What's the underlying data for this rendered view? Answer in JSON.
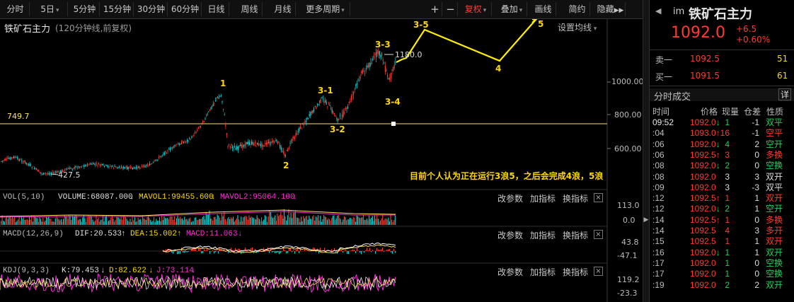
{
  "toolbar": {
    "period_tabs": [
      "分时",
      "5日",
      "5分钟",
      "15分钟",
      "30分钟",
      "60分钟",
      "日线",
      "周线",
      "月线",
      "更多周期"
    ],
    "zoom_in": "+",
    "zoom_out": "−",
    "fq": "复权",
    "overlay": "叠加",
    "draw": "画线",
    "simple": "简约",
    "hide": "隐藏"
  },
  "chart": {
    "title": "铁矿石主力",
    "subtitle": "(120分钟线,前复权)",
    "setting": "设置均线",
    "price_axis": [
      "1000.00",
      "800.00",
      "600.00"
    ],
    "hline_label": "749.7",
    "high_label": "1180.0",
    "low_label": "427.5",
    "wave_labels": [
      "1",
      "2",
      "3-1",
      "3-2",
      "3-3",
      "3-4",
      "3-5",
      "4",
      "5"
    ],
    "annotation": "目前个人认为正在运行3浪5，之后会完成4浪，5浪",
    "colors": {
      "up": "#ff3b30",
      "down": "#00d8d8",
      "wave": "#ffee00",
      "hline": "#ffe066"
    }
  },
  "vol": {
    "name": "VOL(5,10)",
    "volume": "VOLUME:68087.000",
    "mavol1": "MAVOL1:99455.600",
    "mavol2": "MAVOL2:95064.100",
    "axis": [
      "113.0",
      "0.0"
    ]
  },
  "macd": {
    "name": "MACD(12,26,9)",
    "dif": "DIF:20.533",
    "dea": "DEA:15.002",
    "macd": "MACD:11.063",
    "axis": [
      "43.8",
      "-47.1"
    ]
  },
  "kdj": {
    "name": "KDJ(9,3,3)",
    "k": "K:79.453",
    "d": "D:82.622",
    "j": "J:73.114",
    "axis": [
      "119.2",
      "-23.3"
    ]
  },
  "panel_actions": {
    "params": "改参数",
    "add": "加指标",
    "switch": "换指标",
    "close": "×"
  },
  "quote": {
    "code": "im",
    "name": "铁矿石主力",
    "price": "1092.0",
    "change": "+6.5",
    "change_pct": "+0.60%",
    "sell_label": "卖一",
    "sell_price": "1092.5",
    "sell_vol": "51",
    "buy_label": "买一",
    "buy_price": "1091.5",
    "buy_vol": "61",
    "ticks_title": "分时成交",
    "detail_btn": "详",
    "headers": [
      "时间",
      "价格",
      "现量",
      "仓差",
      "性质"
    ]
  },
  "trades": [
    {
      "time": "09:52",
      "price": "1092.0",
      "dir": "↓",
      "vol": "1",
      "oi": "-1",
      "type": "双平",
      "pc": "up",
      "tc": "dn"
    },
    {
      "time": ":04",
      "price": "1093.0",
      "dir": "↑",
      "vol": "16",
      "oi": "-1",
      "type": "空平",
      "pc": "up",
      "tc": "up"
    },
    {
      "time": ":06",
      "price": "1092.0",
      "dir": "↓",
      "vol": "4",
      "oi": "2",
      "type": "空开",
      "pc": "up",
      "tc": "dn"
    },
    {
      "time": ":06",
      "price": "1092.5",
      "dir": "↑",
      "vol": "3",
      "oi": "0",
      "type": "多换",
      "pc": "up",
      "tc": "up"
    },
    {
      "time": ":08",
      "price": "1092.0",
      "dir": "↓",
      "vol": "2",
      "oi": "0",
      "type": "空换",
      "pc": "up",
      "tc": "dn"
    },
    {
      "time": ":08",
      "price": "1092.0",
      "dir": "",
      "vol": "3",
      "oi": "3",
      "type": "双开",
      "pc": "up",
      "tc": "wh"
    },
    {
      "time": ":09",
      "price": "1092.0",
      "dir": "",
      "vol": "3",
      "oi": "-3",
      "type": "双平",
      "pc": "up",
      "tc": "wh"
    },
    {
      "time": ":12",
      "price": "1092.5",
      "dir": "↑",
      "vol": "1",
      "oi": "1",
      "type": "双开",
      "pc": "up",
      "tc": "up"
    },
    {
      "time": ":12",
      "price": "1092.0",
      "dir": "↓",
      "vol": "2",
      "oi": "1",
      "type": "空开",
      "pc": "up",
      "tc": "dn"
    },
    {
      "time": ":14",
      "price": "1092.5",
      "dir": "↑",
      "vol": "1",
      "oi": "0",
      "type": "多换",
      "pc": "up",
      "tc": "up"
    },
    {
      "time": ":14",
      "price": "1092.5",
      "dir": "",
      "vol": "4",
      "oi": "3",
      "type": "多开",
      "pc": "up",
      "tc": "up"
    },
    {
      "time": ":15",
      "price": "1092.5",
      "dir": "",
      "vol": "1",
      "oi": "1",
      "type": "双开",
      "pc": "up",
      "tc": "up"
    },
    {
      "time": ":16",
      "price": "1092.0",
      "dir": "↓",
      "vol": "1",
      "oi": "1",
      "type": "双开",
      "pc": "up",
      "tc": "dn"
    },
    {
      "time": ":17",
      "price": "1092.0",
      "dir": "",
      "vol": "1",
      "oi": "0",
      "type": "空换",
      "pc": "up",
      "tc": "dn"
    },
    {
      "time": ":17",
      "price": "1092.0",
      "dir": "",
      "vol": "1",
      "oi": "0",
      "type": "空换",
      "pc": "up",
      "tc": "dn"
    },
    {
      "time": ":19",
      "price": "1092.0",
      "dir": "",
      "vol": "2",
      "oi": "2",
      "type": "双开",
      "pc": "up",
      "tc": "dn"
    }
  ]
}
